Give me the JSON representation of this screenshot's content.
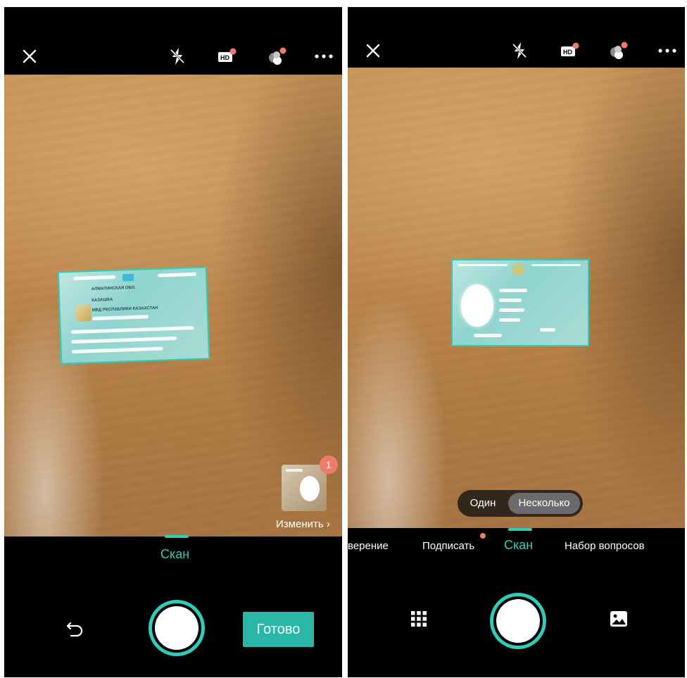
{
  "left_screen": {
    "topbar": {
      "icons": [
        "close-icon",
        "flash-off-icon",
        "hd-icon",
        "filter-icon",
        "more-icon"
      ]
    },
    "thumbnail": {
      "badge_count": "1",
      "edit_label": "Изменить ›"
    },
    "mode": {
      "active_label": "Скан"
    },
    "bottom": {
      "done_label": "Готово",
      "icons": [
        "undo-icon",
        "shutter-button"
      ]
    }
  },
  "right_screen": {
    "topbar": {
      "icons": [
        "close-icon",
        "flash-off-icon",
        "hd-icon",
        "filter-icon",
        "more-icon"
      ]
    },
    "toggle": {
      "option_one": "Один",
      "option_many": "Несколько",
      "selected": "Несколько"
    },
    "modes": [
      {
        "label": "верение"
      },
      {
        "label": "Подписать"
      },
      {
        "label": "Скан",
        "active": true
      },
      {
        "label": "Набор вопросов"
      }
    ],
    "bottom": {
      "icons": [
        "grid-icon",
        "shutter-button",
        "gallery-icon"
      ]
    }
  },
  "colors": {
    "accent": "#2fcdb9",
    "done_button": "#2ab7a7",
    "badge": "#f07a6c",
    "background": "#000000"
  }
}
